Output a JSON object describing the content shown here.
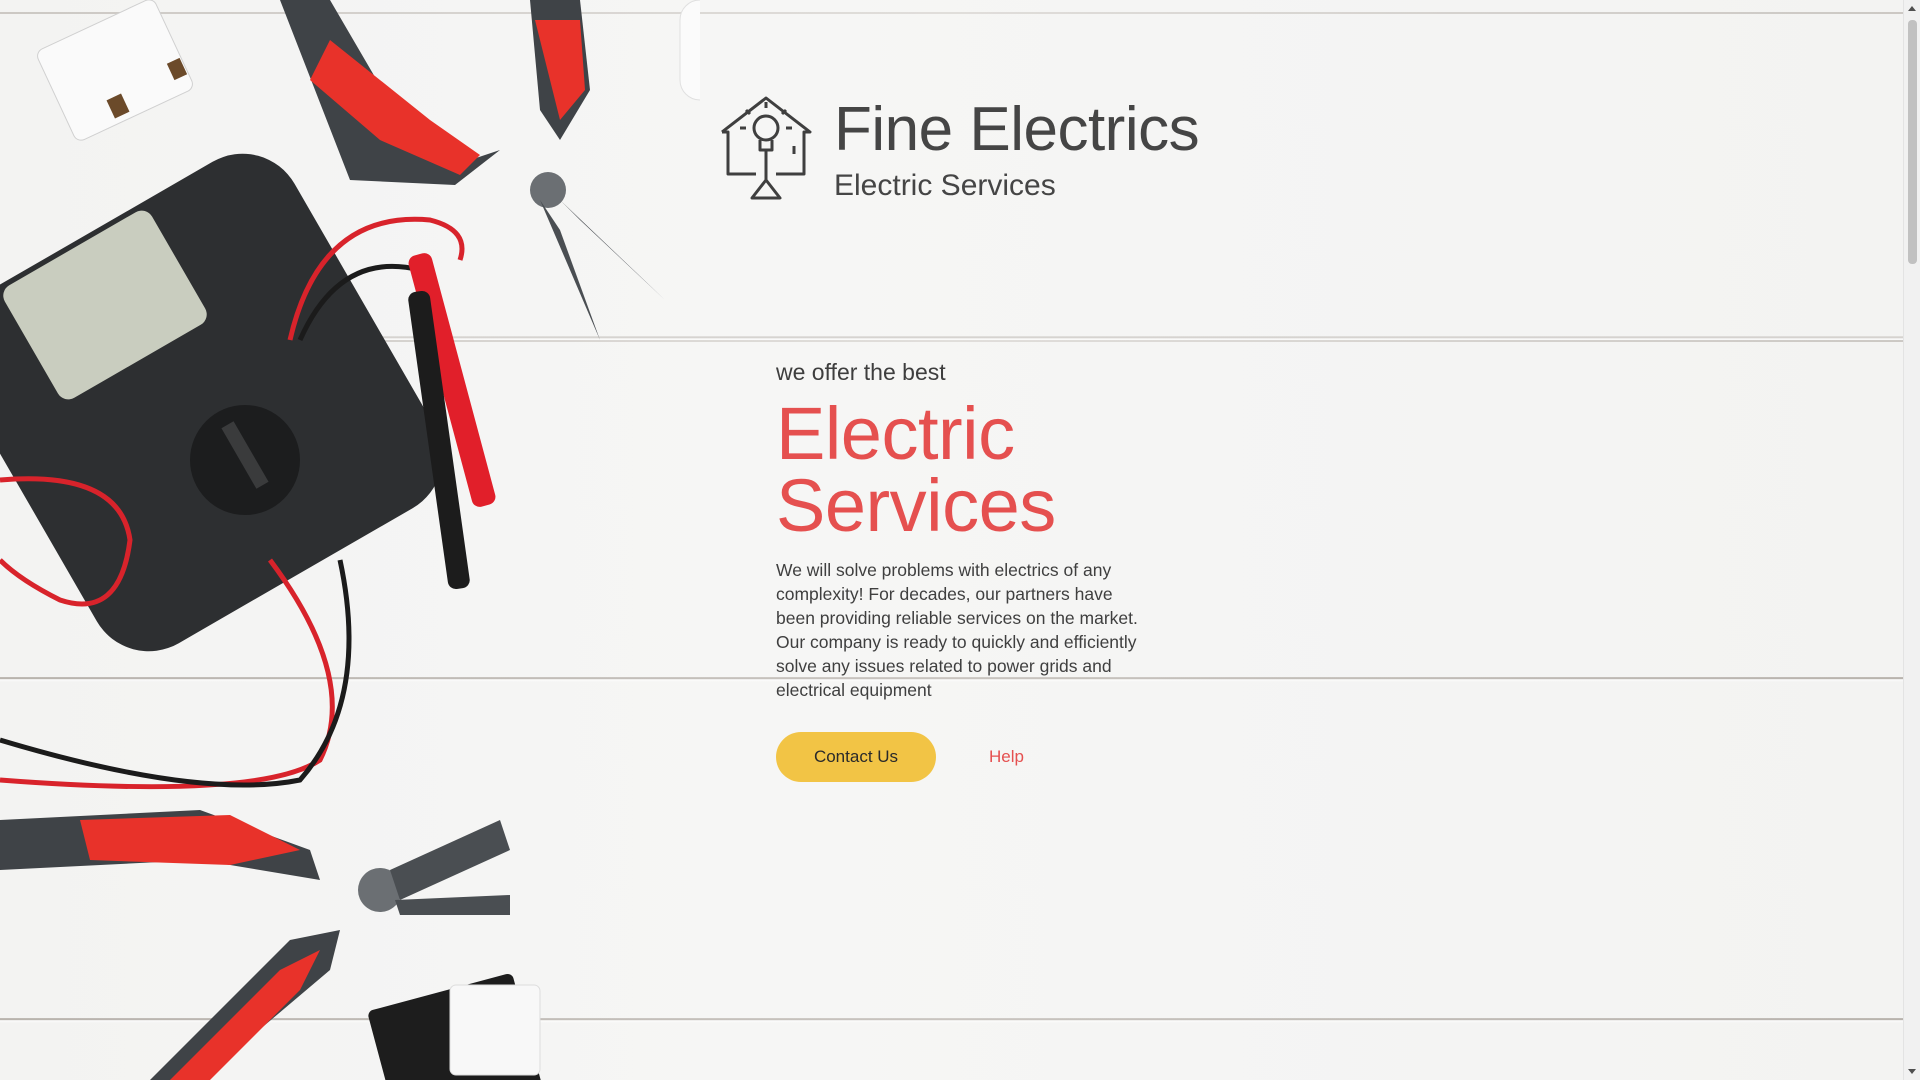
{
  "brand": {
    "name": "Fine Electrics",
    "subtitle": "Electric Services"
  },
  "hero": {
    "tagline": "we offer the best",
    "headline_line1": "Electric",
    "headline_line2": "Services",
    "description": "We will solve problems with electrics of any complexity! For decades, our partners have been providing reliable services on the market. Our company is ready to quickly and efficiently solve any issues related to power grids and electrical equipment"
  },
  "actions": {
    "contact_label": "Contact Us",
    "help_label": "Help"
  },
  "colors": {
    "accent_red": "#e5504f",
    "button_yellow": "#f2c445",
    "text_dark": "#454545"
  },
  "icons": {
    "logo": "lightbulb-house-icon"
  }
}
